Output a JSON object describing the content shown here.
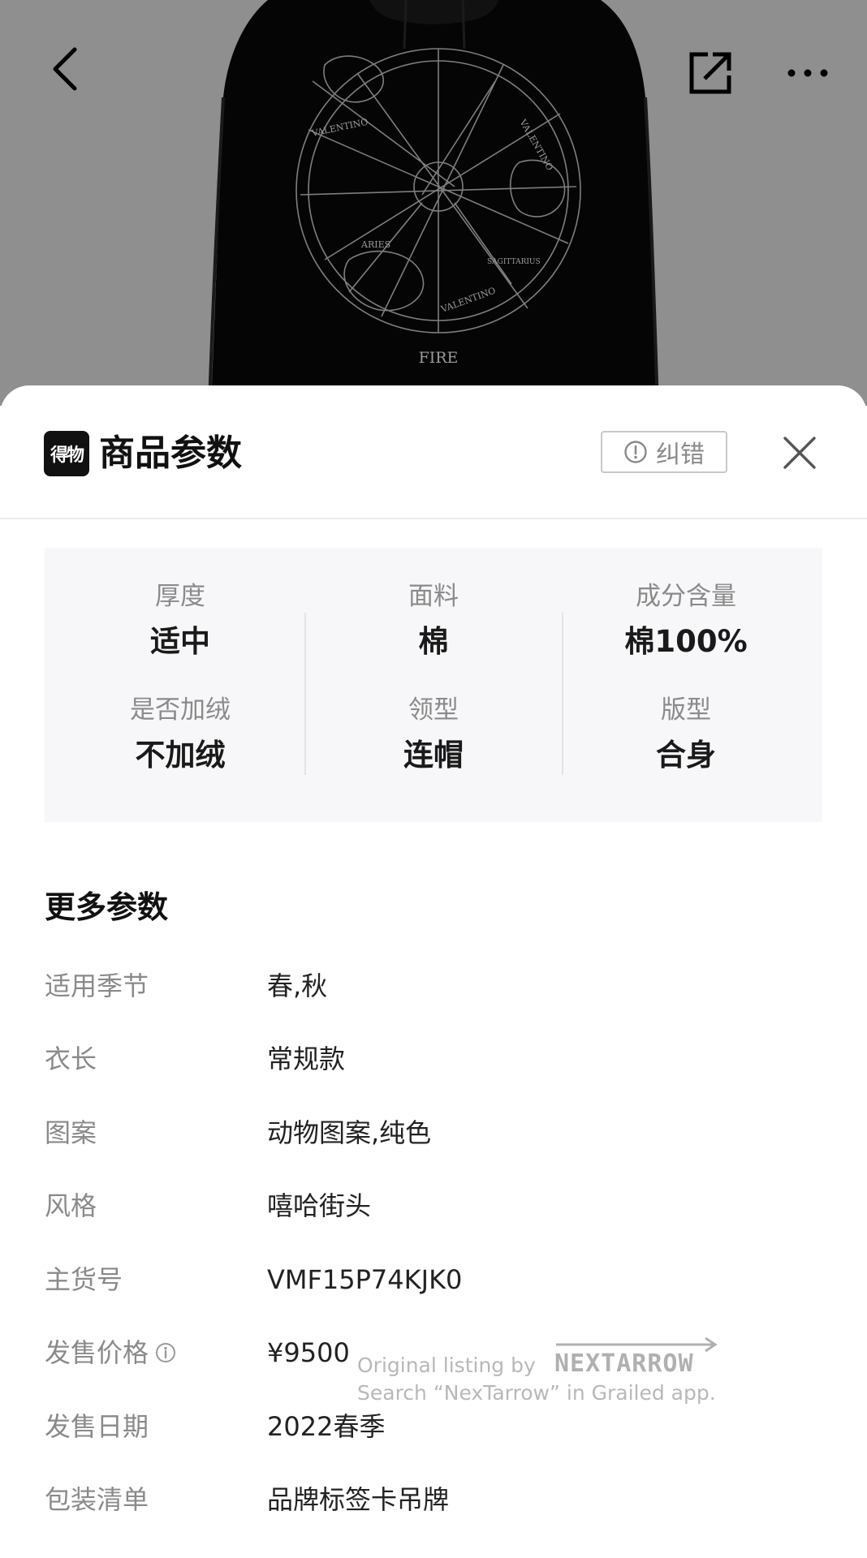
{
  "hero": {
    "print_text": "FIRE",
    "constellation_labels": [
      "VALENTINO",
      "VALENTINO",
      "ARIES",
      "SAGITTARIUS",
      "VALENTINO"
    ]
  },
  "header": {
    "logo_text": "得物",
    "title": "商品参数",
    "report_label": "纠错"
  },
  "key_params": [
    {
      "label": "厚度",
      "value": "适中"
    },
    {
      "label": "面料",
      "value": "棉"
    },
    {
      "label": "成分含量",
      "value": "棉100%"
    },
    {
      "label": "是否加绒",
      "value": "不加绒"
    },
    {
      "label": "领型",
      "value": "连帽"
    },
    {
      "label": "版型",
      "value": "合身"
    }
  ],
  "more_params": {
    "title": "更多参数",
    "rows": [
      {
        "label": "适用季节",
        "value": "春,秋"
      },
      {
        "label": "衣长",
        "value": "常规款"
      },
      {
        "label": "图案",
        "value": "动物图案,纯色"
      },
      {
        "label": "风格",
        "value": "嘻哈街头"
      },
      {
        "label": "主货号",
        "value": "VMF15P74KJK0"
      },
      {
        "label": "发售价格",
        "value": "¥9500"
      },
      {
        "label": "发售日期",
        "value": "2022春季"
      },
      {
        "label": "包装清单",
        "value": "品牌标签卡吊牌"
      }
    ]
  },
  "watermark": {
    "line1": "Original listing by",
    "brand": "NEXTARROW",
    "line2": "Search “NexTarrow” in Grailed app."
  },
  "icons": [
    "back-arrow-icon",
    "share-icon",
    "more-dots-icon",
    "alert-circle-icon",
    "close-icon",
    "info-circle-icon"
  ]
}
